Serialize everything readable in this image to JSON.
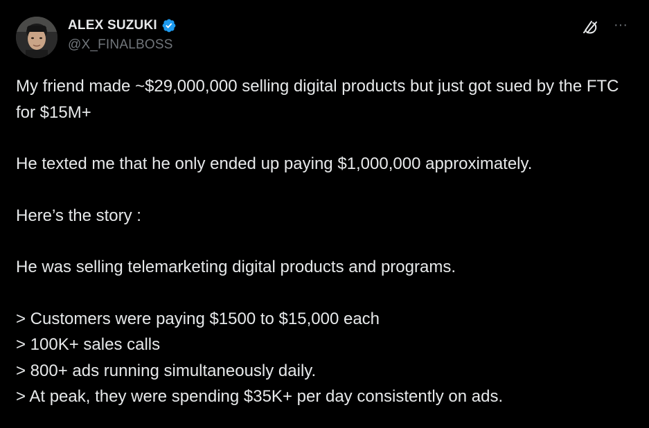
{
  "author": {
    "display_name": "ALEX SUZUKI",
    "handle": "@X_FINALBOSS",
    "verified": true,
    "verified_color": "#1d9bf0",
    "avatar_icon": "avatar-photo"
  },
  "actions": {
    "grok_icon": "grok-icon",
    "more_label": "···"
  },
  "body": {
    "para1": "My friend made ~$29,000,000 selling digital products but just got sued by the FTC for $15M+",
    "para2": "He texted me that he only ended up paying $1,000,000 approximately.",
    "para3": "Here’s the story :",
    "para4": "He was selling telemarketing digital products and programs.",
    "bullets": [
      "> Customers were paying $1500 to $15,000 each",
      "> 100K+ sales calls",
      "> 800+ ads running simultaneously daily.",
      "> At peak, they were spending $35K+ per day consistently on ads."
    ]
  },
  "colors": {
    "background": "#000000",
    "text_primary": "#e7e9ea",
    "text_secondary": "#71767b"
  }
}
